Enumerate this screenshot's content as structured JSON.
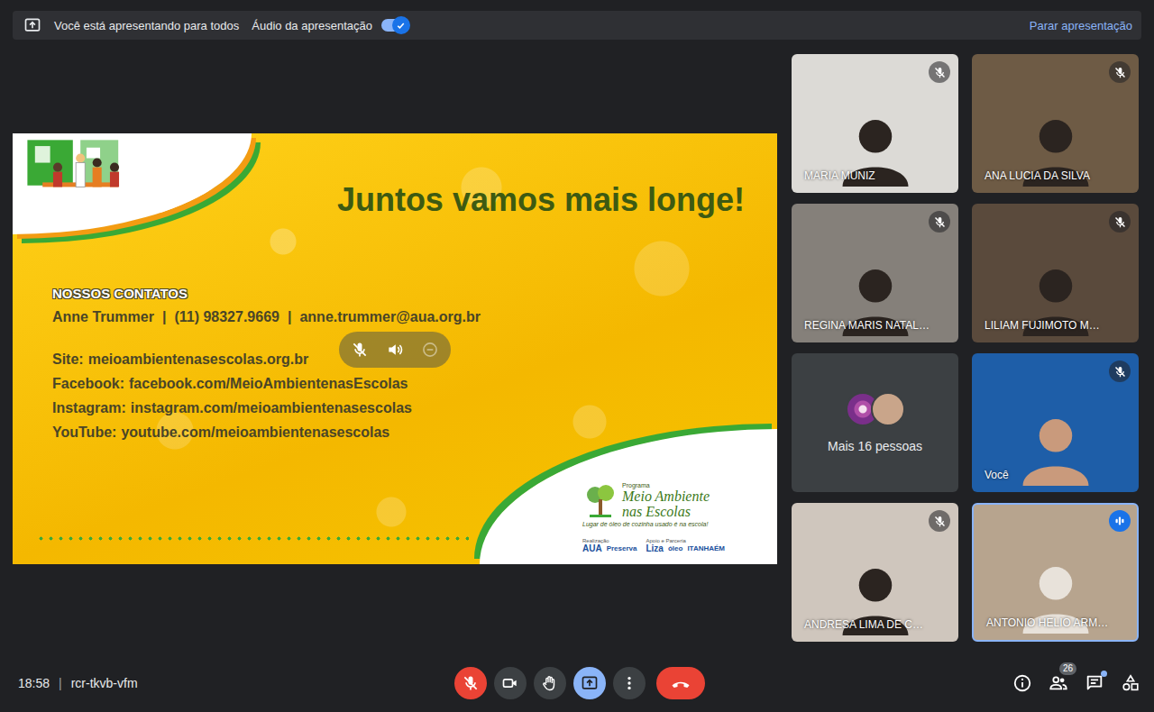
{
  "presentation_bar": {
    "message": "Você está apresentando para todos",
    "audio_label": "Áudio da apresentação",
    "audio_on": true,
    "stop_label": "Parar apresentação"
  },
  "slide": {
    "title": "Juntos vamos mais longe!",
    "contacts_heading": "NOSSOS CONTATOS",
    "contact": [
      "Anne Trummer",
      "(11) 98327.9669",
      "anne.trummer@aua.org.br"
    ],
    "contact_separator": "|",
    "links": [
      {
        "label": "Site:",
        "value": "meioambientenasescolas.org.br"
      },
      {
        "label": "Facebook:",
        "value": "facebook.com/MeioAmbientenasEscolas"
      },
      {
        "label": "Instagram:",
        "value": "instagram.com/meioambientenasescolas"
      },
      {
        "label": "YouTube:",
        "value": "youtube.com/meioambientenasescolas"
      }
    ],
    "logo": {
      "kicker": "Programa",
      "name_lines": [
        "Meio Ambiente",
        "nas Escolas"
      ],
      "tagline": "Lugar de óleo de cozinha usado é na escola!"
    },
    "sponsors": [
      {
        "caption": "Realização",
        "names": [
          "AUA",
          "Preserva"
        ]
      },
      {
        "caption": "Apoio e Parceria",
        "names": [
          "Liza",
          "óleo",
          "ITANHAÉM"
        ]
      }
    ]
  },
  "slide_controls": {
    "muted": true,
    "remove_disabled": true
  },
  "participants": [
    {
      "name": "MARIA MUNIZ",
      "kind": "camera",
      "muted": true,
      "speaking": false
    },
    {
      "name": "ANA LUCIA DA SILVA",
      "kind": "camera",
      "muted": true,
      "speaking": false
    },
    {
      "name": "REGINA MARIS NATAL…",
      "kind": "camera",
      "muted": true,
      "speaking": false
    },
    {
      "name": "LILIAM FUJIMOTO M…",
      "kind": "camera",
      "muted": true,
      "speaking": false
    },
    {
      "name": "Mais 16 pessoas",
      "kind": "overflow",
      "muted": false,
      "speaking": false
    },
    {
      "name": "Você",
      "kind": "camera",
      "muted": true,
      "speaking": false
    },
    {
      "name": "ANDRESA LIMA DE C…",
      "kind": "camera",
      "muted": true,
      "speaking": false
    },
    {
      "name": "ANTONIO HELIO ARM…",
      "kind": "camera",
      "muted": false,
      "speaking": true
    }
  ],
  "bottom_bar": {
    "time": "18:58",
    "separator": "|",
    "meeting_code": "rcr-tkvb-vfm",
    "controls": [
      {
        "kind": "mic",
        "on": false
      },
      {
        "kind": "camera",
        "on": true
      },
      {
        "kind": "hand",
        "on": false
      },
      {
        "kind": "present",
        "on": true
      },
      {
        "kind": "more"
      },
      {
        "kind": "leave"
      }
    ],
    "side": [
      {
        "kind": "info"
      },
      {
        "kind": "people",
        "badge": "26"
      },
      {
        "kind": "chat",
        "unread": true
      },
      {
        "kind": "activities"
      }
    ]
  }
}
